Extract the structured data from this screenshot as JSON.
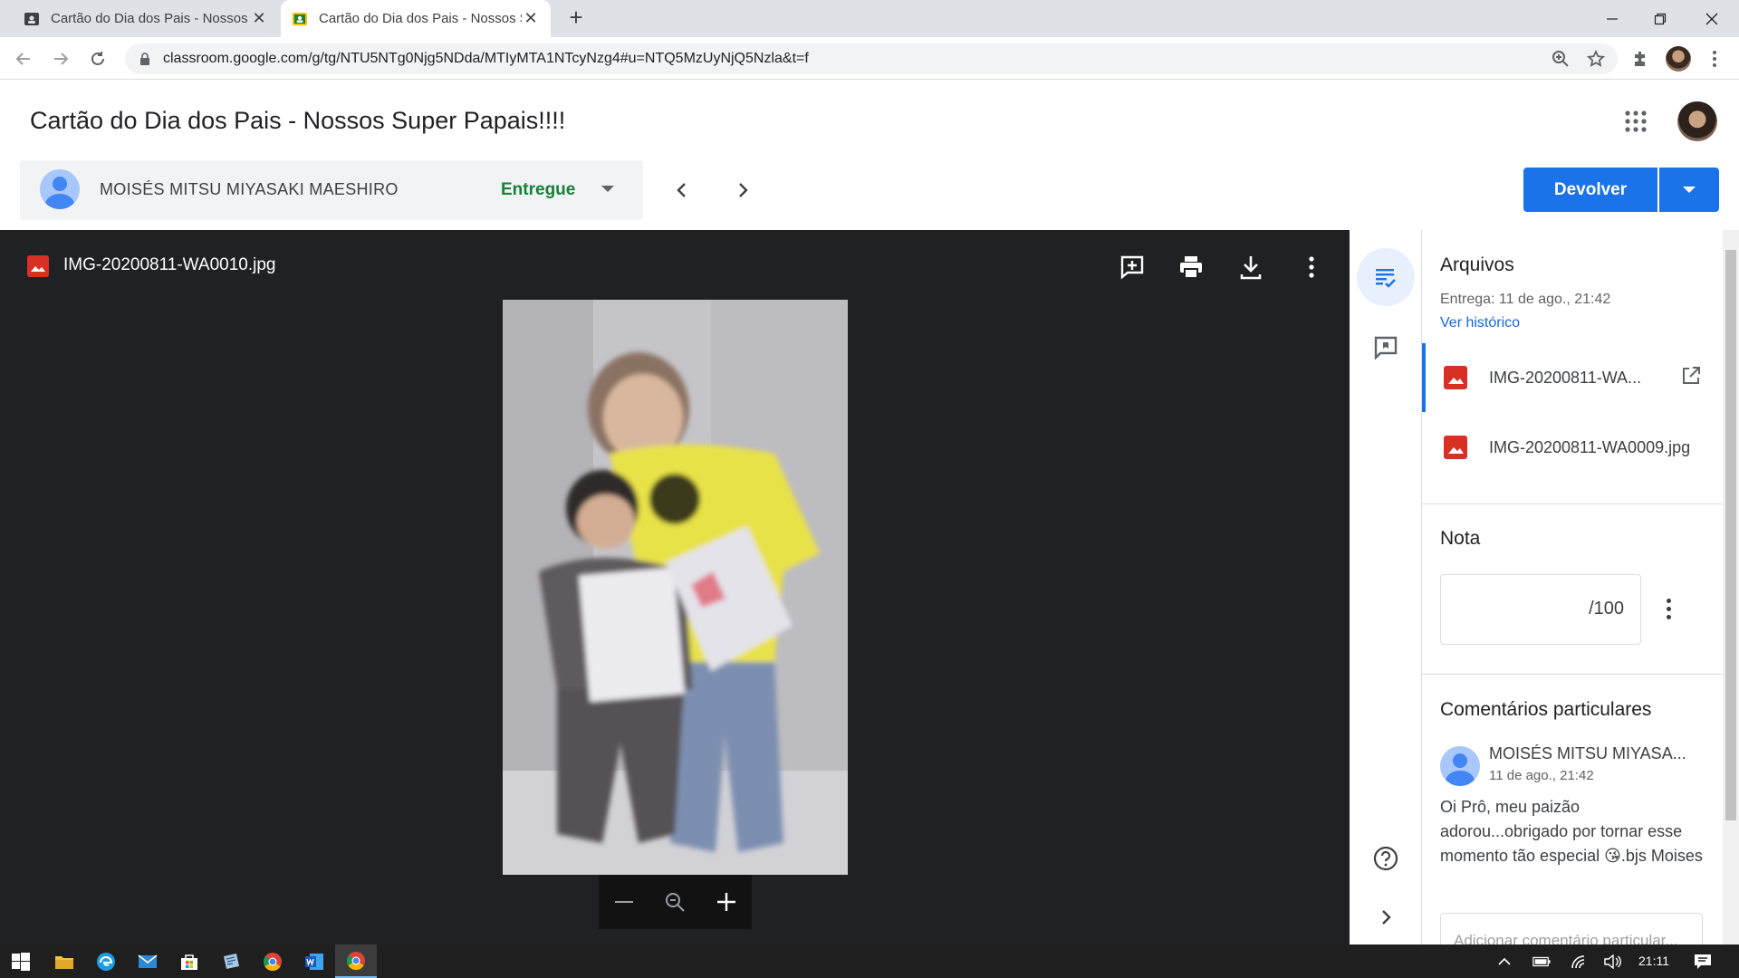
{
  "browser": {
    "tabs": [
      {
        "title": "Cartão do Dia dos Pais - Nossos Super Papais!!!!",
        "active": false
      },
      {
        "title": "Cartão do Dia dos Pais - Nossos Super Papais!!!!",
        "active": true
      }
    ],
    "url": "classroom.google.com/g/tg/NTU5NTg0Njg5NDda/MTIyMTA1NTcyNzg4#u=NTQ5MzUyNjQ5Nzla&t=f"
  },
  "header": {
    "title": "Cartão do Dia dos Pais - Nossos Super Papais!!!!",
    "student_name": "MOISÉS MITSU MIYASAKI MAESHIRO",
    "status": "Entregue",
    "return_button": "Devolver"
  },
  "viewer": {
    "filename": "IMG-20200811-WA0010.jpg"
  },
  "panel": {
    "files_title": "Arquivos",
    "submitted": "Entrega: 11 de ago., 21:42",
    "history_link": "Ver histórico",
    "files": [
      {
        "name": "IMG-20200811-WA...",
        "selected": true
      },
      {
        "name": "IMG-20200811-WA0009.jpg",
        "selected": false
      }
    ],
    "grade_title": "Nota",
    "grade_max": "/100",
    "comments_title": "Comentários particulares",
    "comment": {
      "author": "MOISÉS MITSU MIYASA...",
      "date": "11 de ago., 21:42",
      "text": "Oi Prô, meu paizão adorou...obrigado por tornar esse momento tão especial 😘.bjs Moises"
    },
    "comment_placeholder": "Adicionar comentário particular..."
  },
  "taskbar": {
    "clock": "21:11"
  },
  "colors": {
    "accent": "#1a73e8",
    "status_green": "#188038",
    "viewer_bg": "#202124",
    "image_red": "#d93025"
  }
}
